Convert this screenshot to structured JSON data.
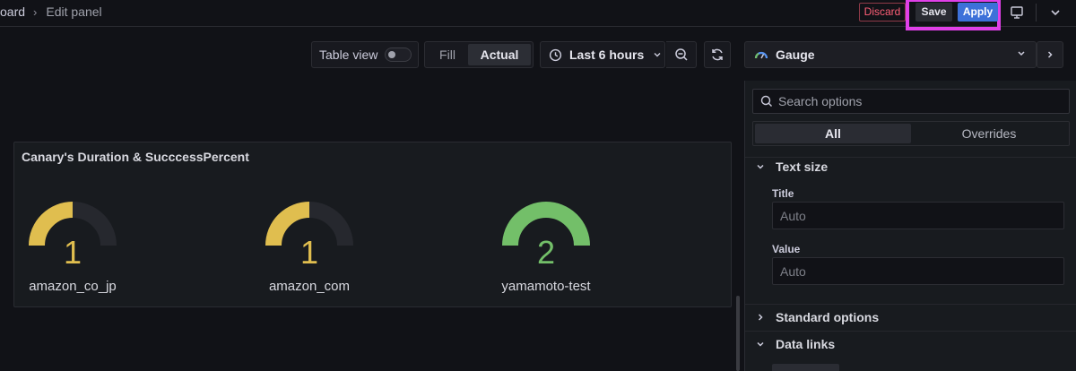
{
  "header": {
    "breadcrumb_parent": "oard",
    "breadcrumb_current": "Edit panel",
    "discard_label": "Discard",
    "save_label": "Save",
    "apply_label": "Apply"
  },
  "toolbar": {
    "table_view_label": "Table view",
    "table_view_on": false,
    "fill_label": "Fill",
    "actual_label": "Actual",
    "time_range_label": "Last 6 hours"
  },
  "visualization": {
    "type_label": "Gauge"
  },
  "panel": {
    "title": "Canary's Duration & SucccessPercent",
    "gauges": [
      {
        "name": "amazon_co_jp",
        "value": "1",
        "color": "#e0be4f"
      },
      {
        "name": "amazon_com",
        "value": "1",
        "color": "#e0be4f"
      },
      {
        "name": "yamamoto-test",
        "value": "2",
        "color": "#73bf69"
      }
    ]
  },
  "options": {
    "search_placeholder": "Search options",
    "tabs": [
      "All",
      "Overrides"
    ],
    "text_size_section": "Text size",
    "title_field_label": "Title",
    "title_field_placeholder": "Auto",
    "value_field_label": "Value",
    "value_field_placeholder": "Auto",
    "standard_options_section": "Standard options",
    "data_links_section": "Data links"
  },
  "colors": {
    "accent_apply": "#3d71d9",
    "discard": "#ff5f77",
    "highlight": "#e040e8",
    "gauge_track": "#26282e"
  }
}
